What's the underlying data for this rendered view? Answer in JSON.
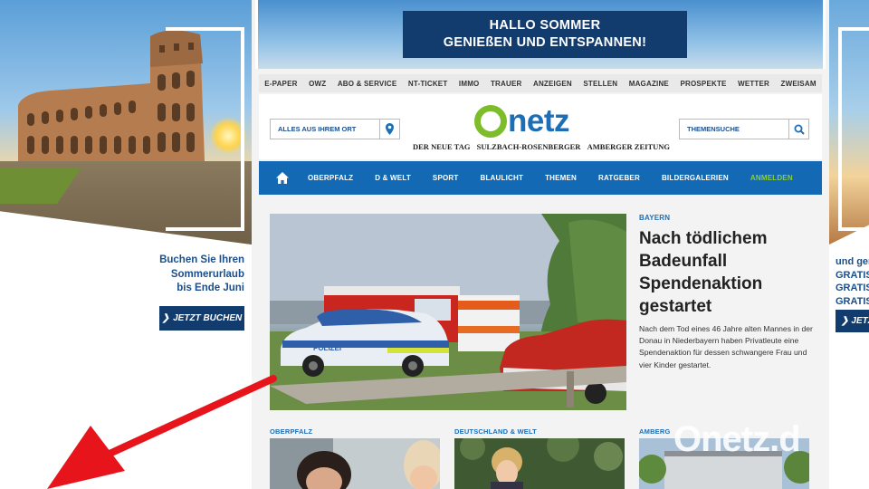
{
  "left_ad": {
    "text_lines": [
      "Buchen Sie Ihren",
      "Sommerurlaub",
      "bis Ende Juni"
    ],
    "button_label": "JETZT BUCHEN"
  },
  "right_ad": {
    "text_lines": [
      "und gen",
      "GRATIS",
      "GRATIS",
      "GRATIS"
    ],
    "button_label": "JETZ"
  },
  "top_banner": {
    "line1": "HALLO SOMMER",
    "line2": "GENIEßEN UND ENTSPANNEN!"
  },
  "topnav": [
    "E-PAPER",
    "OWZ",
    "ABO & SERVICE",
    "NT-TICKET",
    "IMMO",
    "TRAUER",
    "ANZEIGEN",
    "STELLEN",
    "MAGAZINE",
    "PROSPEKTE",
    "WETTER",
    "ZWEISAM"
  ],
  "header": {
    "location_placeholder": "ALLES AUS IHREM ORT",
    "logo_text": "netz",
    "subtitles": [
      "DER NEUE TAG",
      "SULZBACH-ROSENBERGER",
      "AMBERGER ZEITUNG"
    ],
    "search_placeholder": "THEMENSUCHE"
  },
  "mainnav": [
    "OBERPFALZ",
    "D & WELT",
    "SPORT",
    "BLAULICHT",
    "THEMEN",
    "RATGEBER",
    "BILDERGALERIEN"
  ],
  "mainnav_login": "ANMELDEN",
  "hero": {
    "image_text": "POLIZEI",
    "kicker": "BAYERN",
    "headline_lines": [
      "Nach tödlichem",
      "Badeunfall",
      "Spendenaktion",
      "gestartet"
    ],
    "teaser": "Nach dem Tod eines 46 Jahre alten Mannes in der Donau in Niederbayern haben Privatleute eine Spendenaktion für dessen schwangere Frau und vier Kinder gestartet."
  },
  "teasers": [
    {
      "kicker": "OBERPFALZ"
    },
    {
      "kicker": "DEUTSCHLAND & WELT"
    },
    {
      "kicker": "AMBERG"
    }
  ],
  "watermark": "Onetz.d",
  "colors": {
    "brand_blue": "#1469b4",
    "brand_green": "#7dbd2a",
    "ad_navy": "#123c6e",
    "arrow_red": "#e8141b"
  }
}
